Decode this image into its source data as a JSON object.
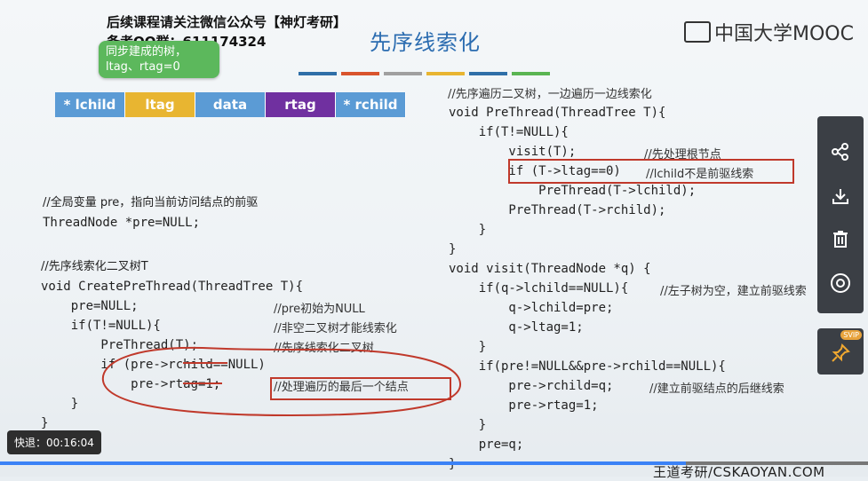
{
  "header": {
    "line1": "后续课程请关注微信公众号【神灯考研】",
    "line2": "备考QQ群：611174324"
  },
  "slide_title": "先序线索化",
  "title_bar_colors": [
    "#2f6fa8",
    "#d9542c",
    "#a0a0a0",
    "#e8b531",
    "#2f6fa8",
    "#5ab552"
  ],
  "logo_text": "中国大学MOOC",
  "tooltip": {
    "line1": "同步建成的树，",
    "line2": "ltag、rtag=0"
  },
  "node_struct": [
    {
      "label": "* lchild",
      "color": "#5b9bd5"
    },
    {
      "label": "ltag",
      "color": "#e8b531"
    },
    {
      "label": "data",
      "color": "#5b9bd5"
    },
    {
      "label": "rtag",
      "color": "#7030a0"
    },
    {
      "label": "* rchild",
      "color": "#5b9bd5"
    }
  ],
  "left_code": {
    "global_comment": "//全局变量 pre，指向当前访问结点的前驱",
    "global_decl": "ThreadNode *pre=NULL;",
    "func_comment": "//先序线索化二叉树T",
    "lines": [
      {
        "code": "void CreatePreThread(ThreadTree T){",
        "comment": ""
      },
      {
        "code": "    pre=NULL;",
        "comment": "//pre初始为NULL"
      },
      {
        "code": "    if(T!=NULL){",
        "comment": "//非空二叉树才能线索化"
      },
      {
        "code": "        PreThread(T);",
        "comment": "//先序线索化二叉树"
      },
      {
        "code": "        if (pre->rchild==NULL)",
        "comment": ""
      },
      {
        "code": "            pre->rtag=1;",
        "comment": "//处理遍历的最后一个结点"
      },
      {
        "code": "    }",
        "comment": ""
      },
      {
        "code": "}",
        "comment": ""
      }
    ]
  },
  "right_code": {
    "comment": "//先序遍历二叉树，一边遍历一边线索化",
    "lines": [
      {
        "code": "void PreThread(ThreadTree T){",
        "comment": ""
      },
      {
        "code": "    if(T!=NULL){",
        "comment": ""
      },
      {
        "code": "        visit(T);",
        "comment": "//先处理根节点"
      },
      {
        "code": "        if (T->ltag==0)",
        "comment": "//lchild不是前驱线索"
      },
      {
        "code": "            PreThread(T->lchild);",
        "comment": ""
      },
      {
        "code": "        PreThread(T->rchild);",
        "comment": ""
      },
      {
        "code": "    }",
        "comment": ""
      },
      {
        "code": "}",
        "comment": ""
      },
      {
        "code": "void visit(ThreadNode *q) {",
        "comment": ""
      },
      {
        "code": "    if(q->lchild==NULL){",
        "comment": "//左子树为空，建立前驱线索"
      },
      {
        "code": "        q->lchild=pre;",
        "comment": ""
      },
      {
        "code": "        q->ltag=1;",
        "comment": ""
      },
      {
        "code": "    }",
        "comment": ""
      },
      {
        "code": "    if(pre!=NULL&&pre->rchild==NULL){",
        "comment": ""
      },
      {
        "code": "        pre->rchild=q;",
        "comment": "//建立前驱结点的后继线索"
      },
      {
        "code": "        pre->rtag=1;",
        "comment": ""
      },
      {
        "code": "    }",
        "comment": ""
      },
      {
        "code": "    pre=q;",
        "comment": ""
      },
      {
        "code": "}",
        "comment": ""
      }
    ]
  },
  "player": {
    "speed_label": "快退：00:16:04",
    "progress_fraction": 0.79,
    "side_icons": [
      "share-icon",
      "download-icon",
      "trash-icon",
      "record-icon"
    ],
    "pin_badge": "SVIP"
  },
  "watermark": "王道考研/CSKAOYAN.COM"
}
